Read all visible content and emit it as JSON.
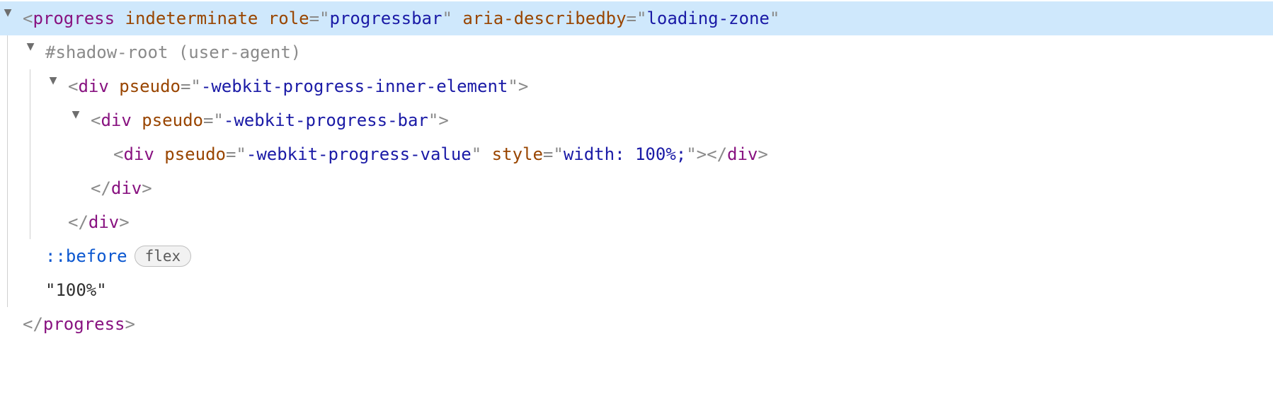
{
  "lines": {
    "l0": {
      "tag": "progress",
      "attrs": {
        "indeterminate": "indeterminate",
        "role_name": "role",
        "role_val": "progressbar",
        "aria_name": "aria-describedby",
        "aria_val": "loading-zone"
      }
    },
    "shadow_root": "#shadow-root (user-agent)",
    "l1": {
      "tag": "div",
      "attr": "pseudo",
      "val": "-webkit-progress-inner-element"
    },
    "l2": {
      "tag": "div",
      "attr": "pseudo",
      "val": "-webkit-progress-bar"
    },
    "l3": {
      "tag": "div",
      "attr1": "pseudo",
      "val1": "-webkit-progress-value",
      "attr2": "style",
      "val2": "width: 100%;",
      "close": "div"
    },
    "l4_close": "div",
    "l5_close": "div",
    "pseudo_before": "::before",
    "badge_flex": "flex",
    "text_node": "\"100%\"",
    "close_progress": "progress"
  },
  "symbols": {
    "lt": "<",
    "gt": ">",
    "slash": "/",
    "eq": "=",
    "q": "\""
  }
}
